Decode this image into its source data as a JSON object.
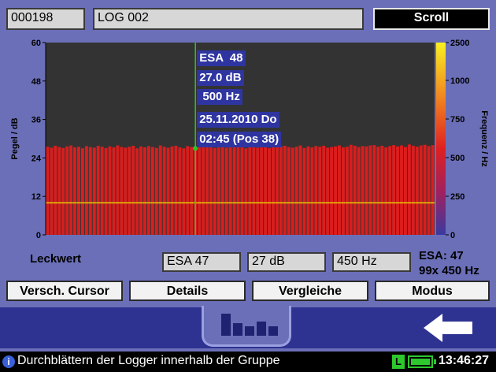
{
  "header": {
    "id_value": "000198",
    "log_name": "LOG 002",
    "scroll_label": "Scroll"
  },
  "chart_data": {
    "type": "bar",
    "ylabel": "Pegel / dB",
    "y2label": "Frequenz / Hz",
    "ylim": [
      0,
      60
    ],
    "y2lim": [
      0,
      2500
    ],
    "yticks": [
      0,
      12,
      24,
      36,
      48,
      60
    ],
    "y2ticks": [
      0,
      250,
      500,
      750,
      1000,
      2500
    ],
    "threshold": 10,
    "cursor_index": 38,
    "values": [
      27.5,
      27.2,
      27.8,
      27.4,
      27.1,
      27.6,
      27.9,
      27.3,
      27.5,
      27.0,
      27.7,
      27.4,
      27.2,
      27.8,
      27.5,
      27.1,
      27.6,
      27.3,
      27.9,
      27.4,
      27.2,
      27.5,
      27.8,
      27.0,
      27.6,
      27.3,
      27.7,
      27.4,
      27.1,
      27.9,
      27.5,
      27.2,
      27.6,
      27.8,
      27.3,
      27.0,
      27.7,
      27.4,
      27.0,
      27.6,
      27.8,
      27.3,
      27.5,
      27.1,
      27.9,
      27.4,
      27.2,
      27.7,
      27.5,
      27.3,
      27.8,
      27.0,
      27.6,
      27.4,
      27.2,
      27.9,
      27.5,
      27.1,
      27.7,
      27.3,
      27.6,
      27.8,
      27.4,
      27.2,
      27.5,
      27.9,
      27.1,
      27.6,
      27.3,
      27.7,
      27.5,
      27.8,
      27.2,
      27.4,
      27.6,
      27.9,
      27.3,
      27.5,
      28.1,
      27.8,
      27.4,
      27.7,
      27.6,
      27.9,
      28.0,
      27.5,
      27.8,
      27.3,
      27.7,
      28.0,
      27.6,
      27.9,
      27.4,
      28.2,
      27.8,
      27.5,
      27.9,
      28.1,
      27.7,
      28.0
    ],
    "annotations": [
      "ESA  48",
      "27.0 dB",
      " 500 Hz",
      "25.11.2010 Do",
      "02:45 (Pos 38)"
    ]
  },
  "readout": {
    "label": "Leckwert",
    "esa": "ESA 47",
    "level": "27 dB",
    "freq": "450 Hz",
    "summary_line1": "ESA: 47",
    "summary_line2": "99x 450 Hz"
  },
  "softkeys": [
    "Versch. Cursor",
    "Details",
    "Vergleiche",
    "Modus"
  ],
  "status": {
    "info_text": "Durchblättern der Logger innerhalb der Gruppe",
    "battery_label": "L",
    "time": "13:46:27"
  },
  "colors": {
    "bar": "#d81e1e",
    "plot_bg": "#333333",
    "cursor": "#28c828",
    "threshold": "#e8d000",
    "annotation_bg": "#2f35a0"
  }
}
